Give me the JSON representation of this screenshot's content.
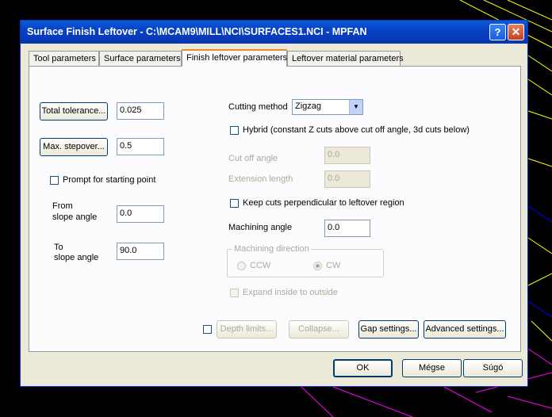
{
  "window": {
    "title": "Surface Finish Leftover - C:\\MCAM9\\MILL\\NCI\\SURFACES1.NCI - MPFAN",
    "help_label": "?",
    "close_label": "✕"
  },
  "tabs": [
    {
      "label": "Tool parameters"
    },
    {
      "label": "Surface parameters"
    },
    {
      "label": "Finish leftover parameters"
    },
    {
      "label": "Leftover material parameters"
    }
  ],
  "left": {
    "total_tolerance_label": "Total tolerance...",
    "total_tolerance_value": "0.025",
    "max_stepover_label": "Max. stepover...",
    "max_stepover_value": "0.5",
    "prompt_start_label": "Prompt for starting point",
    "from_label_1": "From",
    "from_label_2": "slope angle",
    "from_value": "0.0",
    "to_label_1": "To",
    "to_label_2": "slope angle",
    "to_value": "90.0"
  },
  "right": {
    "cutting_method_label": "Cutting method",
    "cutting_method_value": "Zigzag",
    "hybrid_label": "Hybrid (constant Z cuts above cut off angle, 3d cuts below)",
    "cut_off_angle_label": "Cut off angle",
    "cut_off_angle_value": "0.0",
    "extension_length_label": "Extension length",
    "extension_length_value": "0.0",
    "keep_perpendicular_label": "Keep cuts perpendicular to leftover region",
    "machining_angle_label": "Machining angle",
    "machining_angle_value": "0.0",
    "machining_direction_label": "Machining direction",
    "ccw_label": "CCW",
    "cw_label": "CW",
    "expand_label": "Expand inside to outside"
  },
  "bottom_buttons": {
    "depth_limits": "Depth limits...",
    "collapse": "Collapse...",
    "gap_settings": "Gap settings...",
    "advanced_settings": "Advanced settings..."
  },
  "footer": {
    "ok": "OK",
    "cancel": "Mégse",
    "help": "Súgó"
  }
}
